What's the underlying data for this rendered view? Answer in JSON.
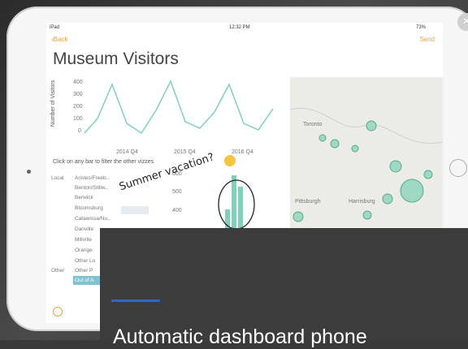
{
  "status": {
    "device": "iPad",
    "time": "12:32 PM",
    "battery": "73%"
  },
  "nav": {
    "back": "Back",
    "send": "Send"
  },
  "title": "Museum Visitors",
  "line_chart": {
    "ylabel": "Number of Visitors",
    "yticks": [
      "400",
      "300",
      "200",
      "100",
      "0"
    ],
    "xticks": [
      "2014 Q4",
      "2015 Q4",
      "2016 Q4"
    ]
  },
  "filter_hint": "Click on any bar to filter the other vizzes",
  "bar_list": {
    "groups": [
      "Local",
      "Other"
    ],
    "rows": [
      "Aristes/Freeb..",
      "Benton/Stillw..",
      "Berwick",
      "Bloomsburg",
      "Catawissa/Nu..",
      "Danville",
      "Millville",
      "Orange",
      "Other Lo",
      "Other P"
    ],
    "selected": "Out of A"
  },
  "annotation": "Summer vacation?",
  "mini_chart": {
    "yticks": [
      "600",
      "500",
      "400"
    ]
  },
  "map": {
    "labels": [
      "Toronto",
      "Pittsburgh",
      "Harrisburg"
    ]
  },
  "overlay": {
    "text": "Automatic dashboard phone"
  },
  "colors": {
    "accent": "#f0a04b",
    "series": "#7fd1b9",
    "overlay": "#3c3c3c",
    "overlay_line": "#2f67c8"
  }
}
